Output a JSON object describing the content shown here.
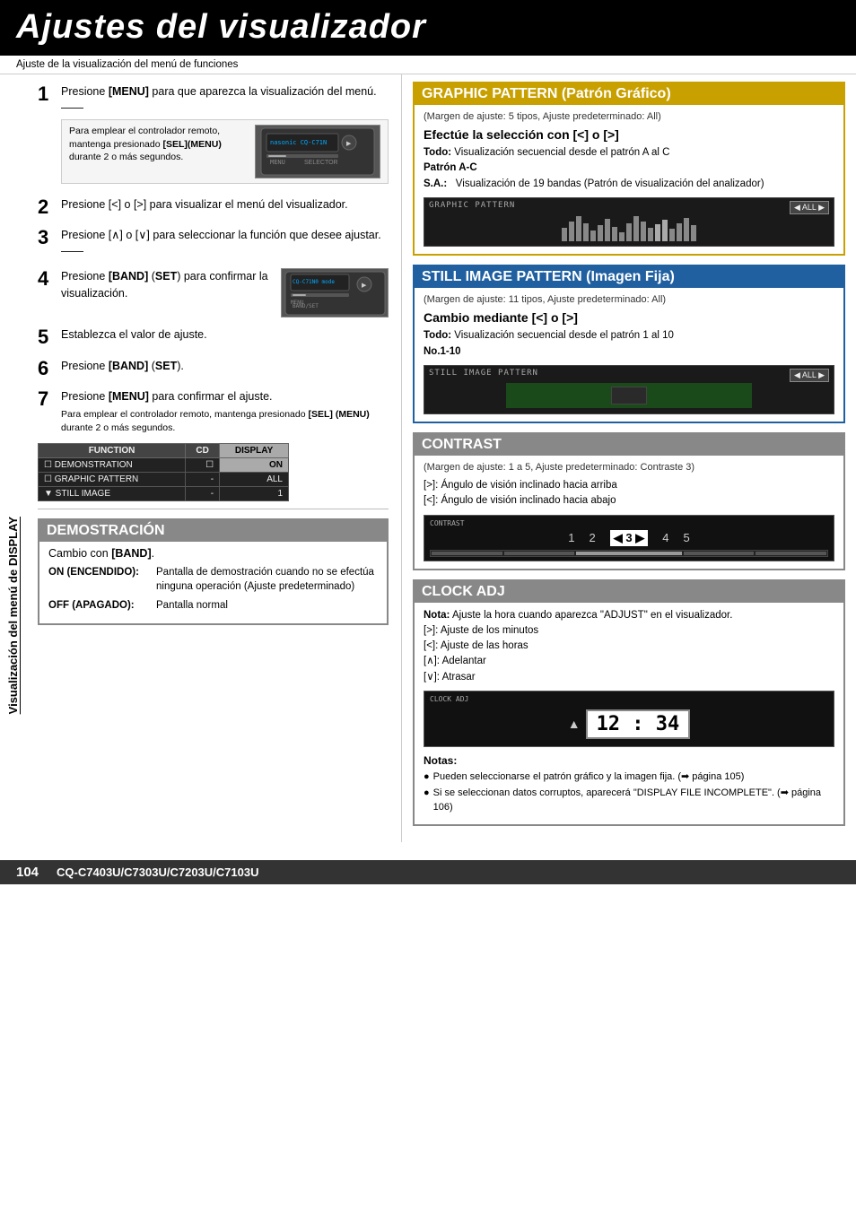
{
  "page": {
    "title": "Ajustes del visualizador",
    "subtitle": "Ajuste de la visualización del menú de funciones",
    "vertical_label": "Visualización del menú de DISPLAY",
    "footer_page": "104",
    "footer_model": "CQ-C7403U/C7303U/C7203U/C7103U"
  },
  "steps": [
    {
      "num": "1",
      "text_pre": "Presione ",
      "text_bold": "[MENU]",
      "text_post": " para que aparezca la visualización del menú.",
      "has_note": true,
      "note": "Para emplear el controlador remoto, mantenga presionado [SEL](MENU) durante 2 o más segundos."
    },
    {
      "num": "2",
      "text_pre": "Presione [",
      "text_symbol": "<",
      "text_mid": "] o [",
      "text_symbol2": ">",
      "text_post": "] para visualizar el menú del visualizador.",
      "full_text": "Presione [<] o [>] para visualizar el menú del visualizador."
    },
    {
      "num": "3",
      "full_text": "Presione [∧] o [∨] para seleccionar la función que desee ajustar."
    },
    {
      "num": "4",
      "text_pre": "Presione ",
      "text_bold": "[BAND]",
      "text_post": " (SET) para confirmar la visualización.",
      "has_device": true
    },
    {
      "num": "5",
      "full_text": "Establezca el valor de ajuste."
    },
    {
      "num": "6",
      "text_pre": "Presione ",
      "text_bold": "[BAND]",
      "text_post": " (SET)."
    },
    {
      "num": "7",
      "text_pre": "Presione ",
      "text_bold": "[MENU]",
      "text_post": " para confirmar el ajuste.",
      "has_note2": true,
      "note2": "Para emplear el controlador remoto, mantenga presionado [SEL] (MENU) durante 2 o más segundos."
    }
  ],
  "table": {
    "headers": [
      "FUNCTION",
      "CD",
      "DISPLAY"
    ],
    "rows": [
      {
        "icon": "□",
        "name": "DEMONSTRATION",
        "col2": "□",
        "col3": "ON"
      },
      {
        "icon": "□",
        "name": "GRAPHIC PATTERN",
        "col2": "-",
        "col3": "ALL"
      },
      {
        "icon": "▼",
        "name": "STILL IMAGE",
        "col2": "-",
        "col3": "1"
      }
    ]
  },
  "demo_section": {
    "title": "DEMOSTRACIÓN",
    "subtitle": "Cambio con [BAND].",
    "on_label": "ON (ENCENDIDO):",
    "on_desc": "Pantalla de demostración cuando no se efectúa ninguna operación (Ajuste predeterminado)",
    "off_label": "OFF (APAGADO):",
    "off_desc": "Pantalla normal"
  },
  "graphic_pattern": {
    "title": "GRAPHIC PATTERN (Patrón Gráfico)",
    "margin_note": "(Margen de ajuste: 5 tipos, Ajuste predeterminado: All)",
    "subtitle": "Efectúe la selección con [<] o [>]",
    "todo_label": "Todo:",
    "todo_desc": "Visualización secuencial desde el patrón A al C",
    "patron_label": "Patrón A-C",
    "sa_label": "S.A.:",
    "sa_desc": "Visualización de 19 bandas (Patrón de visualización del analizador)"
  },
  "still_image": {
    "title": "STILL IMAGE PATTERN (Imagen Fija)",
    "margin_note": "(Margen de ajuste: 11 tipos, Ajuste predeterminado: All)",
    "subtitle": "Cambio mediante [<] o [>]",
    "todo_label": "Todo:",
    "todo_desc": "Visualización secuencial desde el patrón 1 al 10",
    "no_label": "No.1-10"
  },
  "contrast": {
    "title": "CONTRAST",
    "margin_note": "(Margen de ajuste: 1 a 5, Ajuste predeterminado: Contraste 3)",
    "right_arrow_desc": "[>]: Ángulo de visión inclinado hacia arriba",
    "left_arrow_desc": "[<]: Ángulo de visión inclinado hacia abajo",
    "numbers": [
      "1",
      "2",
      "3",
      "4",
      "5"
    ],
    "active_num": "3"
  },
  "clock_adj": {
    "title": "CLOCK ADJ",
    "nota_label": "Nota:",
    "nota_desc": "Ajuste la hora cuando aparezca \"ADJUST\" en el visualizador.",
    "right_desc": "[>]: Ajuste de los minutos",
    "left_desc": "[<]: Ajuste de las horas",
    "up_desc": "[∧]: Adelantar",
    "down_desc": "[∨]: Atrasar",
    "display_time": "12 : 34"
  },
  "notas": {
    "title": "Notas:",
    "items": [
      "Pueden seleccionarse el patrón gráfico y la imagen fija. (➡ página 105)",
      "Si se seleccionan datos corruptos, aparecerá \"DISPLAY FILE INCOMPLETE\". (➡ página 106)"
    ]
  }
}
